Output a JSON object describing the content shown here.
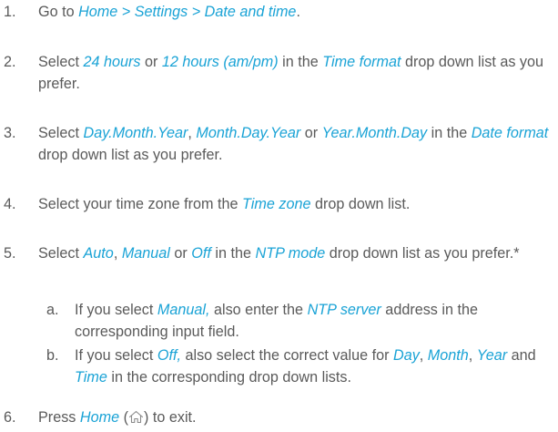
{
  "steps": [
    {
      "num": "1.",
      "parts": [
        {
          "t": "Go to "
        },
        {
          "t": "Home > Settings > Date and time",
          "hl": true
        },
        {
          "t": "."
        }
      ]
    },
    {
      "num": "2.",
      "parts": [
        {
          "t": "Select "
        },
        {
          "t": "24 hours",
          "hl": true
        },
        {
          "t": " or "
        },
        {
          "t": "12 hours (am/pm)",
          "hl": true
        },
        {
          "t": " in the "
        },
        {
          "t": "Time format",
          "hl": true
        },
        {
          "t": " drop down list as you prefer."
        }
      ]
    },
    {
      "num": "3.",
      "parts": [
        {
          "t": "Select "
        },
        {
          "t": "Day.Month.Year",
          "hl": true
        },
        {
          "t": ", "
        },
        {
          "t": "Month.Day.Year",
          "hl": true
        },
        {
          "t": " or "
        },
        {
          "t": "Year.Month.Day",
          "hl": true
        },
        {
          "t": " in the "
        },
        {
          "t": "Date format",
          "hl": true
        },
        {
          "t": " drop down list as you prefer."
        }
      ]
    },
    {
      "num": "4.",
      "parts": [
        {
          "t": "Select your time zone from the "
        },
        {
          "t": "Time zone",
          "hl": true
        },
        {
          "t": " drop down list."
        }
      ]
    },
    {
      "num": "5.",
      "parts": [
        {
          "t": "Select "
        },
        {
          "t": "Auto",
          "hl": true
        },
        {
          "t": ", "
        },
        {
          "t": "Manual",
          "hl": true
        },
        {
          "t": " or "
        },
        {
          "t": "Off",
          "hl": true
        },
        {
          "t": " in the "
        },
        {
          "t": "NTP mode",
          "hl": true
        },
        {
          "t": " drop down list as you prefer.*"
        }
      ],
      "sub": [
        {
          "num": "a.",
          "parts": [
            {
              "t": "If you select "
            },
            {
              "t": "Manual,",
              "hl": true
            },
            {
              "t": " also enter the "
            },
            {
              "t": "NTP server",
              "hl": true
            },
            {
              "t": " address in the corresponding input field."
            }
          ]
        },
        {
          "num": "b.",
          "parts": [
            {
              "t": "If you select "
            },
            {
              "t": "Off,",
              "hl": true
            },
            {
              "t": " also select the correct value for "
            },
            {
              "t": "Day",
              "hl": true
            },
            {
              "t": ", "
            },
            {
              "t": "Month",
              "hl": true
            },
            {
              "t": ", "
            },
            {
              "t": "Year",
              "hl": true
            },
            {
              "t": " and "
            },
            {
              "t": "Time",
              "hl": true
            },
            {
              "t": " in the corresponding drop down lists."
            }
          ]
        }
      ]
    },
    {
      "num": "6.",
      "parts": [
        {
          "t": "Press "
        },
        {
          "t": "Home",
          "hl": true
        },
        {
          "t": " ("
        },
        {
          "icon": "home-icon"
        },
        {
          "t": ") to exit."
        }
      ]
    }
  ],
  "colors": {
    "text": "#5a5a5a",
    "highlight": "#1aa3d6"
  }
}
